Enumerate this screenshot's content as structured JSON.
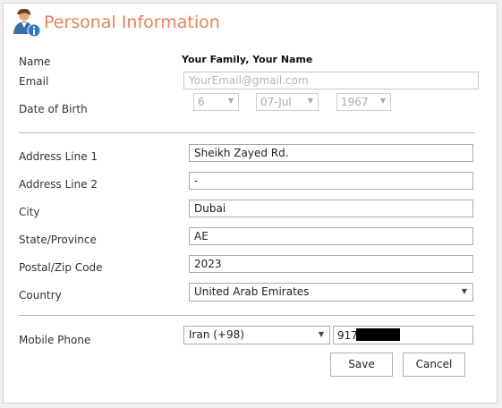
{
  "header": {
    "title": "Personal Information",
    "icon": "user-info-icon"
  },
  "fields": {
    "name": {
      "label": "Name",
      "value": "Your Family, Your Name"
    },
    "email": {
      "label": "Email",
      "placeholder": "YourEmail@gmail.com"
    },
    "dob": {
      "label": "Date of Birth",
      "day": "6",
      "month": "07-Jul",
      "year": "1967"
    },
    "address1": {
      "label": "Address Line 1",
      "value": "Sheikh Zayed Rd."
    },
    "address2": {
      "label": "Address Line 2",
      "value": "-"
    },
    "city": {
      "label": "City",
      "value": "Dubai"
    },
    "state": {
      "label": "State/Province",
      "value": "AE"
    },
    "postal": {
      "label": "Postal/Zip Code",
      "value": "2023"
    },
    "country": {
      "label": "Country",
      "value": "United Arab Emirates"
    },
    "mobile": {
      "label": "Mobile Phone",
      "country_code": "Iran (+98)",
      "number_prefix": "917"
    }
  },
  "buttons": {
    "save": "Save",
    "cancel": "Cancel"
  },
  "colors": {
    "title": "#e8825a",
    "border": "#aaaaaa"
  }
}
